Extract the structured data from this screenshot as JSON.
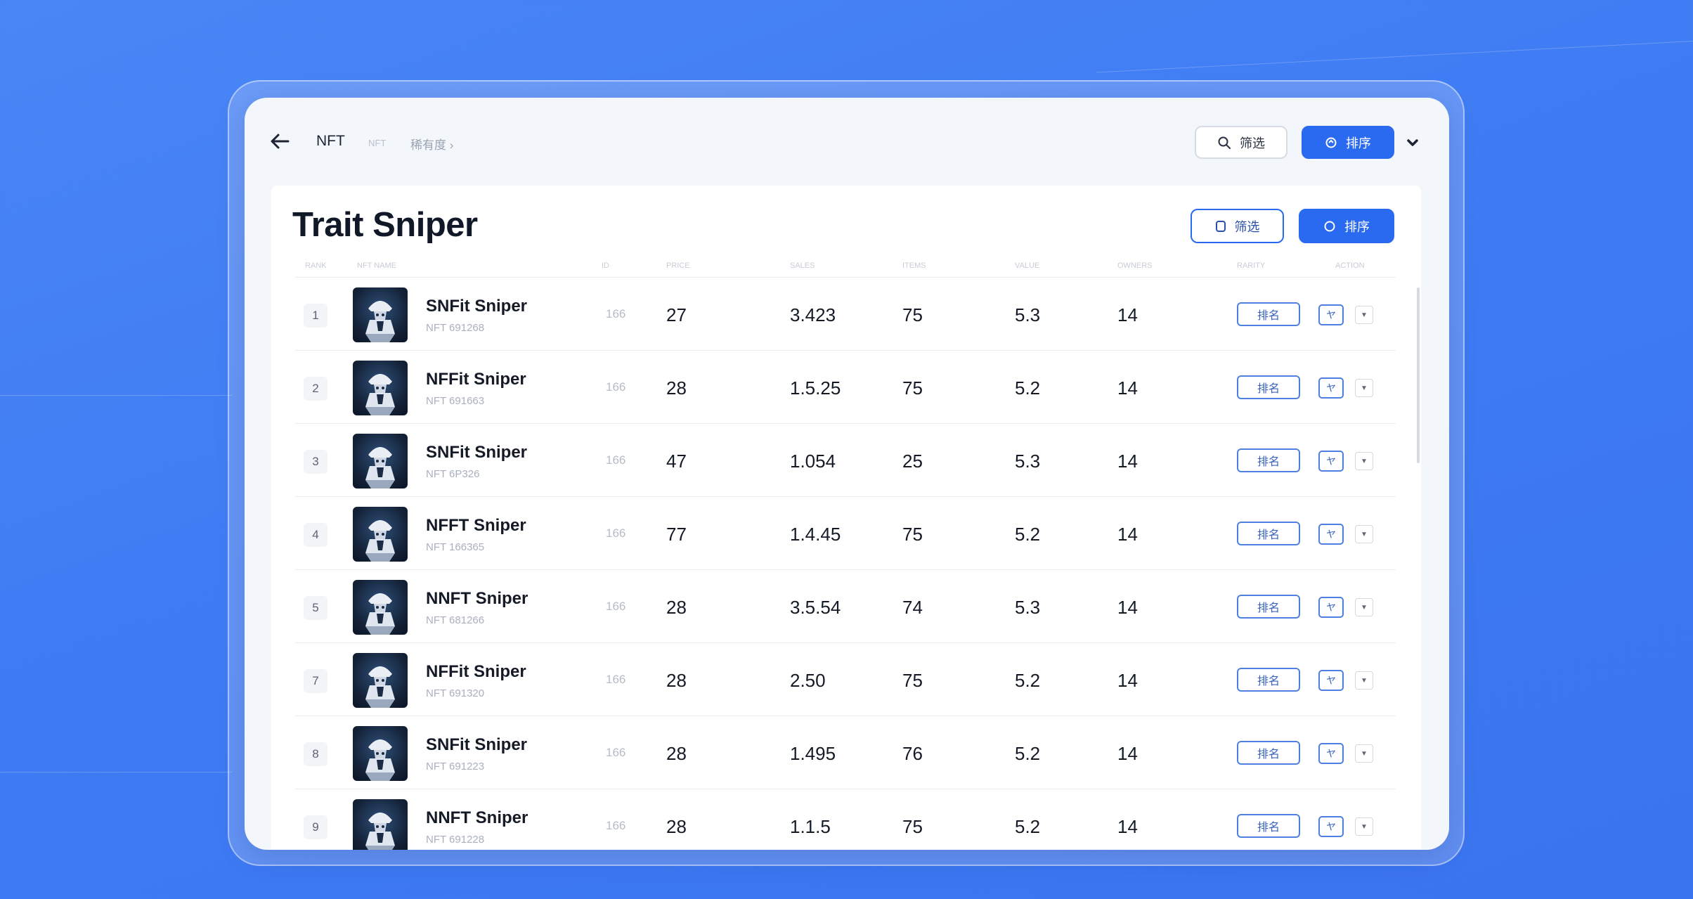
{
  "header": {
    "breadcrumb_root": "NFT",
    "breadcrumb_sub": "NFT",
    "breadcrumb_page": "稀有度 ›",
    "filter_label": "筛选",
    "sort_label": "排序"
  },
  "card": {
    "title": "Trait Sniper",
    "filter_label": "筛选",
    "sort_label": "排序"
  },
  "columns": [
    "RANK",
    "NFT NAME",
    "ID",
    "PRICE",
    "SALES",
    "ITEMS",
    "VALUE",
    "OWNERS",
    "RARITY",
    "ACTION"
  ],
  "rows": [
    {
      "rank": "1",
      "name": "SNFit Sniper",
      "sub": "NFT 691268",
      "small": "166",
      "c1": "27",
      "c2": "3.423",
      "c3": "75",
      "c4": "5.3",
      "c5": "14",
      "action": "排名",
      "mini": "ヤ"
    },
    {
      "rank": "2",
      "name": "NFFit Sniper",
      "sub": "NFT 691663",
      "small": "166",
      "c1": "28",
      "c2": "1.5.25",
      "c3": "75",
      "c4": "5.2",
      "c5": "14",
      "action": "排名",
      "mini": "ヤ"
    },
    {
      "rank": "3",
      "name": "SNFit Sniper",
      "sub": "NFT 6P326",
      "small": "166",
      "c1": "47",
      "c2": "1.054",
      "c3": "25",
      "c4": "5.3",
      "c5": "14",
      "action": "排名",
      "mini": "ヤ"
    },
    {
      "rank": "4",
      "name": "NFFT Sniper",
      "sub": "NFT 166365",
      "small": "166",
      "c1": "77",
      "c2": "1.4.45",
      "c3": "75",
      "c4": "5.2",
      "c5": "14",
      "action": "排名",
      "mini": "ヤ"
    },
    {
      "rank": "5",
      "name": "NNFT Sniper",
      "sub": "NFT 681266",
      "small": "166",
      "c1": "28",
      "c2": "3.5.54",
      "c3": "74",
      "c4": "5.3",
      "c5": "14",
      "action": "排名",
      "mini": "ヤ"
    },
    {
      "rank": "7",
      "name": "NFFit Sniper",
      "sub": "NFT 691320",
      "small": "166",
      "c1": "28",
      "c2": "2.50",
      "c3": "75",
      "c4": "5.2",
      "c5": "14",
      "action": "排名",
      "mini": "ヤ"
    },
    {
      "rank": "8",
      "name": "SNFit Sniper",
      "sub": "NFT 691223",
      "small": "166",
      "c1": "28",
      "c2": "1.495",
      "c3": "76",
      "c4": "5.2",
      "c5": "14",
      "action": "排名",
      "mini": "ヤ"
    },
    {
      "rank": "9",
      "name": "NNFT Sniper",
      "sub": "NFT 691228",
      "small": "166",
      "c1": "28",
      "c2": "1.1.5",
      "c3": "75",
      "c4": "5.2",
      "c5": "14",
      "action": "排名",
      "mini": "ヤ"
    }
  ]
}
